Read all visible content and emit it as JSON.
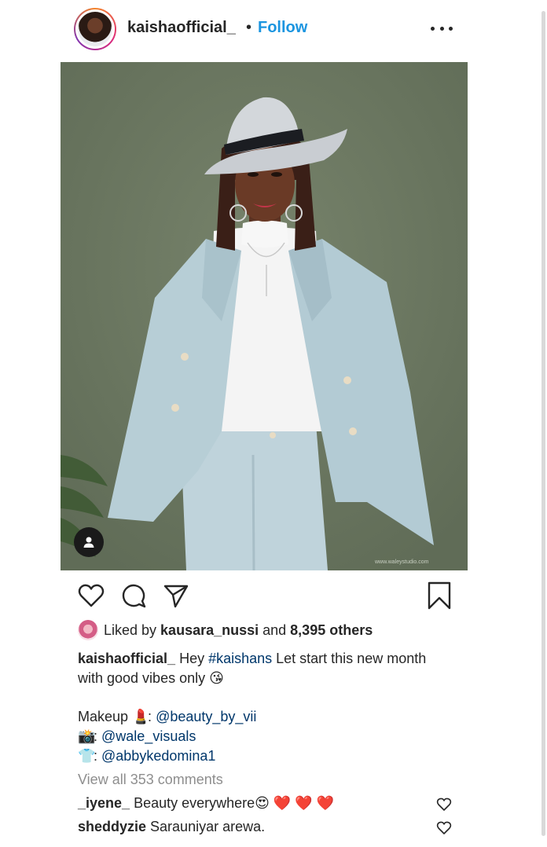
{
  "post": {
    "author": "kaishaofficial_",
    "separator": "•",
    "follow_label": "Follow",
    "more_icon": "more-horizontal-icon"
  },
  "photo": {
    "watermark": "www.waleystudio.com",
    "tag_icon": "user-tag-icon"
  },
  "actions": {
    "like_icon": "heart-outline-icon",
    "comment_icon": "comment-bubble-icon",
    "share_icon": "send-arrow-icon",
    "save_icon": "bookmark-outline-icon"
  },
  "likes": {
    "prefix": "Liked by ",
    "user": "kausara_nussi",
    "connector": " and ",
    "count": "8,395 others"
  },
  "caption": {
    "author": "kaishaofficial_",
    "text_before": " Hey ",
    "hashtag": "#kaishans",
    "text_after": " Let start this new month with good vibes only 😘",
    "credits": [
      {
        "prefix": "Makeup ",
        "emoji": "💄",
        "sep": ": ",
        "handle": "@beauty_by_vii"
      },
      {
        "prefix": "",
        "emoji": "📸",
        "sep": ": ",
        "handle": "@wale_visuals"
      },
      {
        "prefix": "",
        "emoji": "👕",
        "sep": ": ",
        "handle": "@abbykedomina1"
      }
    ]
  },
  "view_all_comments": "View all 353 comments",
  "comments": [
    {
      "user": "_iyene_",
      "text": " Beauty everywhere😍 ❤️ ❤️ ❤️"
    },
    {
      "user": "sheddyzie",
      "text": " Sarauniyar arewa."
    }
  ],
  "colors": {
    "link": "#00376b",
    "follow": "#1b95e0",
    "muted": "#8e8e8e",
    "background_photo": "#6e7a62"
  }
}
